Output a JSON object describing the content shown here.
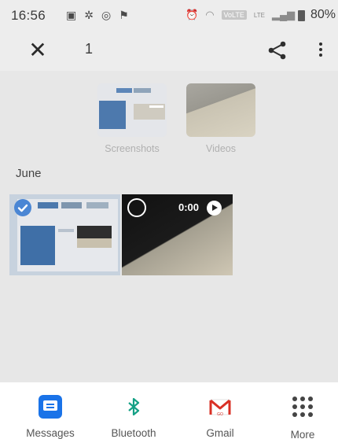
{
  "status_bar": {
    "time": "16:56",
    "volte": "VoLTE",
    "lte": "LTE",
    "battery": "80%"
  },
  "toolbar": {
    "selected_count": "1"
  },
  "albums": [
    {
      "label": "Screenshots"
    },
    {
      "label": "Videos"
    }
  ],
  "section_title": "June",
  "video": {
    "duration": "0:00"
  },
  "share_sheet": {
    "items": [
      {
        "label": "Messages",
        "icon": "messages-icon"
      },
      {
        "label": "Bluetooth",
        "icon": "bluetooth-icon"
      },
      {
        "label": "Gmail",
        "icon": "gmail-icon"
      },
      {
        "label": "More",
        "icon": "more-apps-icon"
      }
    ]
  },
  "colors": {
    "accent": "#1a73e8",
    "selection": "#4a86d4",
    "bluetooth": "#14a085",
    "gmail": "#d93025"
  }
}
